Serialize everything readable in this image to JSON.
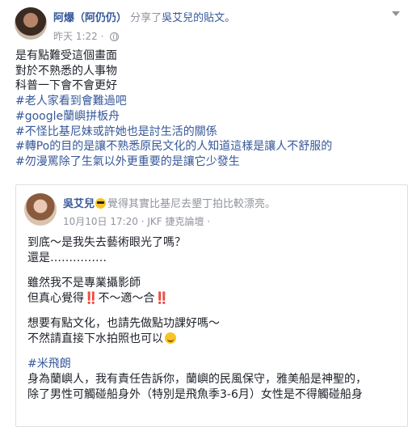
{
  "post": {
    "author": "阿爆（阿仍仍）",
    "shared_text": "分享了",
    "shared_target": "吳艾兒的貼文。",
    "time": "昨天 1:22 ·",
    "body": [
      {
        "text": "是有點難受這個畫面",
        "hashtag": false
      },
      {
        "text": "對於不熟悉的人事物",
        "hashtag": false
      },
      {
        "text": "科普一下會不會更好",
        "hashtag": false
      },
      {
        "text": "#老人家看到會難過吧",
        "hashtag": true
      },
      {
        "text": "#google蘭嶼拼板舟",
        "hashtag": true
      },
      {
        "text": "#不怪比基尼妹或許她也是討生活的關係",
        "hashtag": true
      },
      {
        "text": "#轉Po的目的是讓不熟悉原民文化的人知道這樣是讓人不舒服的",
        "hashtag": true
      },
      {
        "text": "#勿漫罵除了生氣以外更重要的是讓它少發生",
        "hashtag": true
      }
    ]
  },
  "shared_post": {
    "author": "吳艾兒",
    "feeling": "覺得其實比基尼去墾丁拍比較漂亮。",
    "meta": "10月10日 17:20 · JKF 捷克論壇 ·",
    "lines": {
      "l1": "到底～是我失去藝術眼光了嗎？",
      "l2": "還是……………",
      "l3": "雖然我不是專業攝影師",
      "l4_a": "但真心覺得",
      "l4_bang": "‼️",
      "l4_b": "不～適～合",
      "l5": "想要有點文化，也請先做點功課好嗎～",
      "l6": "不然請直接下水拍照也可以",
      "l7": "#米飛朗",
      "l8": "身為蘭嶼人，我有責任告訴你，蘭嶼的民風保守，雅美船是神聖的，",
      "l9": "除了男性可觸碰船身外（特別是飛魚季3-6月）女性是不得觸碰船身"
    }
  },
  "colors": {
    "link": "#365899",
    "muted": "#90949c",
    "text": "#1d2129"
  }
}
